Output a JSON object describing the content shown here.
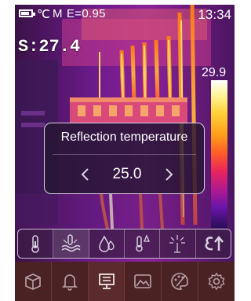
{
  "status_bar": {
    "unit": "℃",
    "mode": "M",
    "emissivity": "E=0.95",
    "time": "13:34"
  },
  "spot_reading": "S:27.4",
  "scale_max": "29.9",
  "dialog": {
    "title": "Reflection temperature",
    "value": "25.0"
  },
  "sub_toolbar": {
    "items": [
      {
        "icon": "thermometer-icon"
      },
      {
        "icon": "reflection-temperature-icon",
        "selected": true
      },
      {
        "icon": "humidity-drop-icon"
      },
      {
        "icon": "temperature-delta-icon"
      },
      {
        "icon": "spark-icon"
      },
      {
        "icon": "emissivity-icon"
      }
    ]
  },
  "bottom_nav": {
    "items": [
      {
        "icon": "package-icon"
      },
      {
        "icon": "bell-icon"
      },
      {
        "icon": "display-icon",
        "selected": true
      },
      {
        "icon": "image-icon"
      },
      {
        "icon": "palette-icon"
      },
      {
        "icon": "gear-icon"
      }
    ]
  },
  "colors": {
    "dialog_bg": "#261632",
    "bottom_bar": "#4a2224",
    "icon_stroke": "#d9d2e0"
  }
}
